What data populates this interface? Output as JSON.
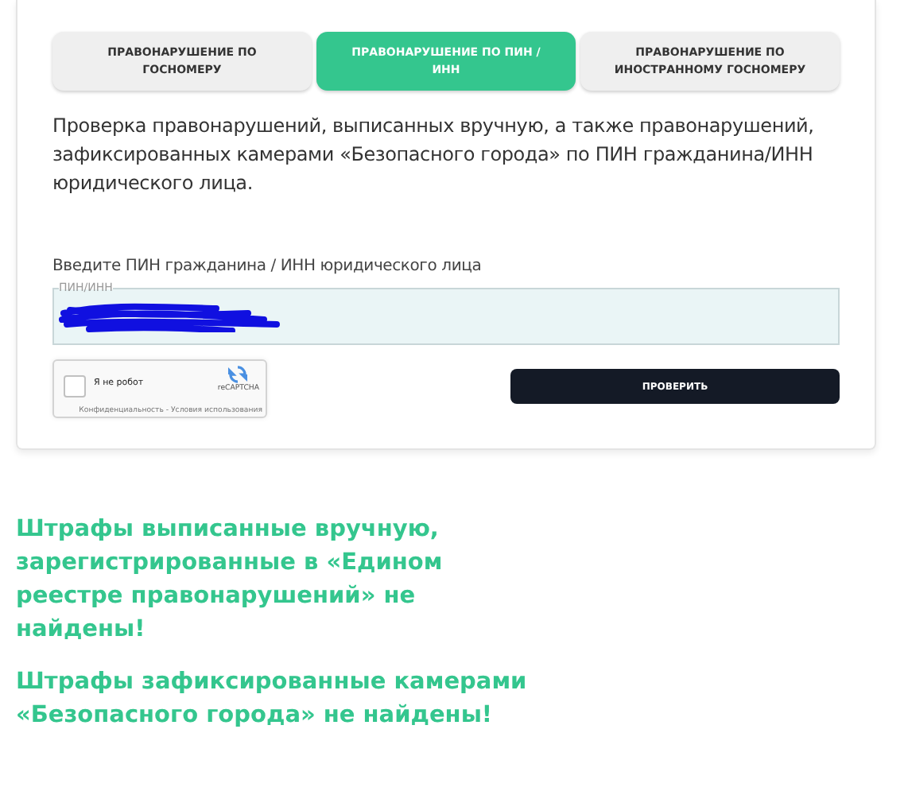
{
  "tabs": [
    {
      "label": "ПРАВОНАРУШЕНИЕ ПО ГОСНОМЕРУ",
      "selected": false
    },
    {
      "label": "ПРАВОНАРУШЕНИЕ ПО ПИН / ИНН",
      "selected": true
    },
    {
      "label": "ПРАВОНАРУШЕНИЕ ПО ИНОСТРАННОМУ ГОСНОМЕРУ",
      "selected": false
    }
  ],
  "description": "Проверка правонарушений, выписанных вручную, а также правонарушений, зафиксированных камерами «Безопасного города» по ПИН гражданина/ИНН юридического лица.",
  "field": {
    "label": "Введите ПИН гражданина / ИНН юридического лица",
    "legend": "ПИН/ИНН",
    "redacted": true
  },
  "captcha": {
    "label": "Я не робот",
    "brand": "reCAPTCHA",
    "terms": "Конфиденциальность - Условия использования",
    "checked": false
  },
  "submit": "ПРОВЕРИТЬ",
  "results": [
    "Штрафы выписанные вручную, зарегистрированные в «Едином реестре правонарушений» не найдены!",
    "Штрафы зафиксированные камерами «Безопасного города» не найдены!"
  ]
}
